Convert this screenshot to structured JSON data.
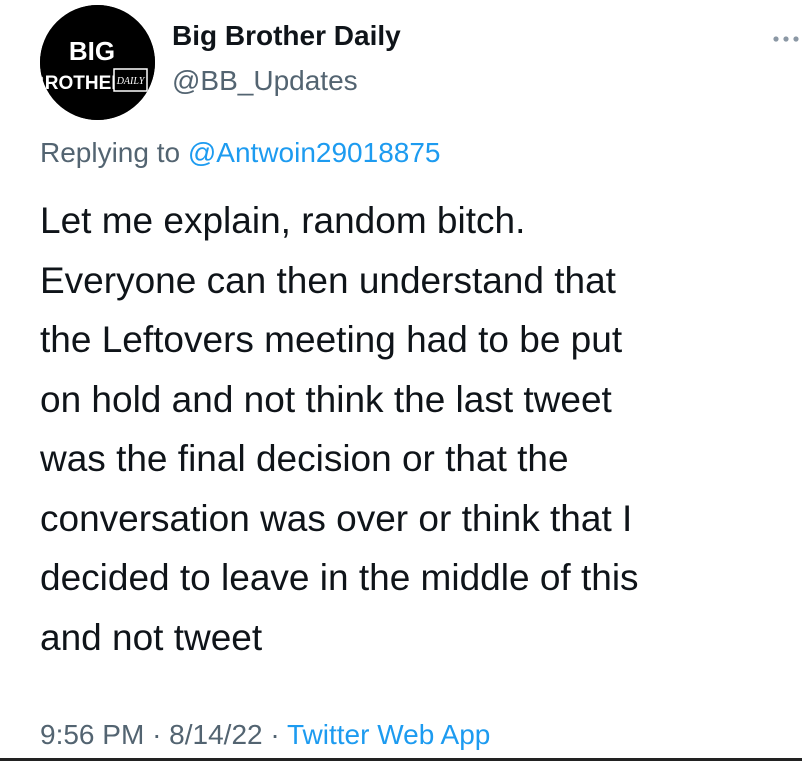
{
  "author": {
    "avatar_logo_text": [
      "BIG",
      "BROTHER",
      "DAILY"
    ],
    "display_name": "Big Brother Daily",
    "handle": "@BB_Updates"
  },
  "reply": {
    "prefix": "Replying to",
    "mention": "@Antwoin29018875"
  },
  "tweet": {
    "lines": [
      "Let me explain, random bitch.",
      "Everyone can then understand that",
      "the Leftovers meeting had to be put",
      "on hold and not think the last tweet",
      "was the final decision or that the",
      "conversation was over or think that I",
      "decided to leave in the middle of this",
      "and not tweet"
    ]
  },
  "meta": {
    "time": "9:56 PM",
    "date": "8/14/22",
    "separator": "·",
    "source": "Twitter Web App"
  },
  "icons": {
    "more": "more-options-icon"
  },
  "colors": {
    "text_primary": "#0f1419",
    "text_secondary": "#536471",
    "link": "#1d9bf0",
    "background": "#ffffff",
    "avatar_bg": "#000000"
  }
}
